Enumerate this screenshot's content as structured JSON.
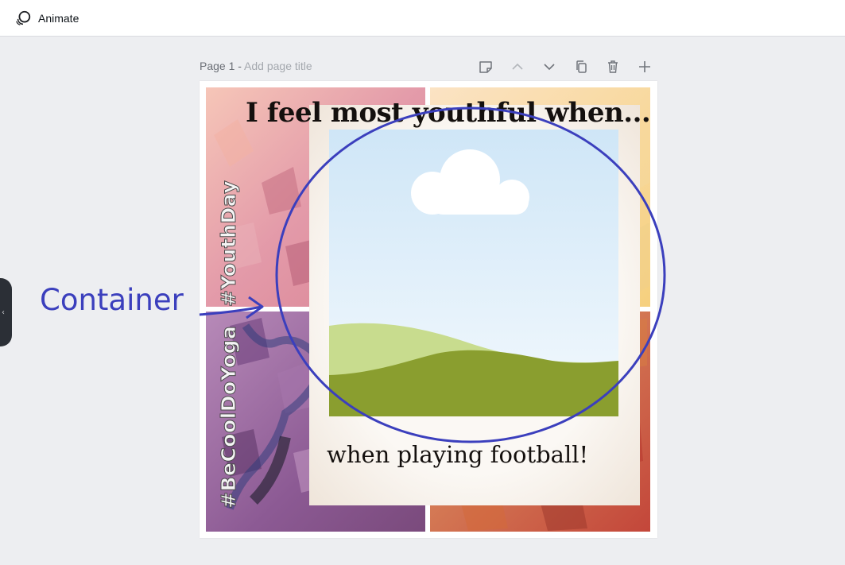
{
  "topbar": {
    "animate_label": "Animate"
  },
  "page": {
    "label": "Page 1 - ",
    "title_placeholder": "Add page title",
    "tools": [
      "notes-icon",
      "chevron-up-icon",
      "chevron-down-icon",
      "duplicate-icon",
      "trash-icon",
      "plus-icon"
    ]
  },
  "design": {
    "headline": "I feel most youthful when....",
    "caption": "when playing football!",
    "hashtag_youth": "#YouthDay",
    "hashtag_yoga": "#BeCoolDoYoga"
  },
  "annotation": {
    "label": "Container",
    "color": "#3b3fbd"
  },
  "colors": {
    "accent": "#3b3fbd",
    "grass_dark": "#8a9e2f",
    "grass_light": "#c8dc8e",
    "sky": "#d2e8f7"
  }
}
